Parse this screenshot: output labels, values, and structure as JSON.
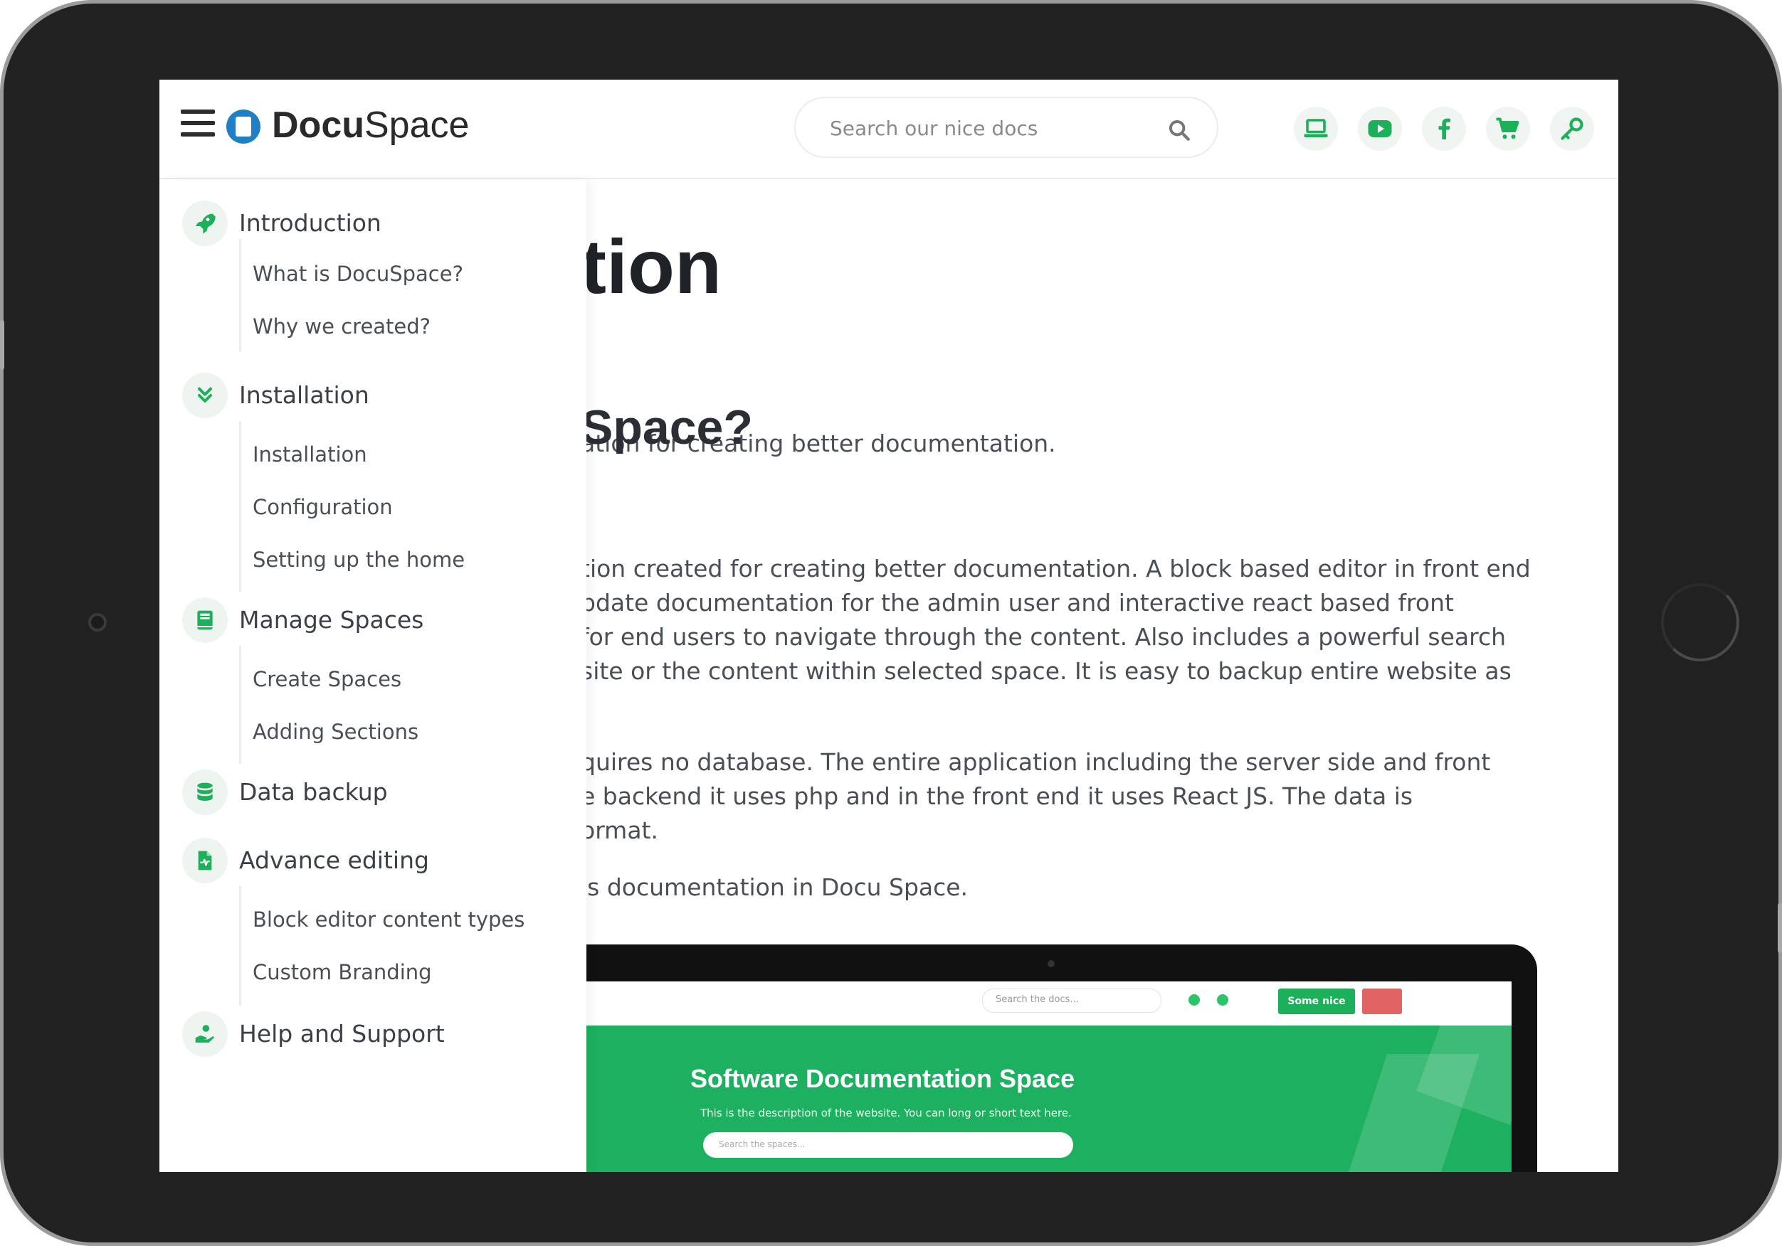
{
  "brand": {
    "name_bold": "Docu",
    "name_light": "Space"
  },
  "search": {
    "placeholder": "Search our nice docs"
  },
  "header_icons": [
    "laptop-icon",
    "youtube-icon",
    "facebook-icon",
    "cart-icon",
    "key-icon"
  ],
  "colors": {
    "accent": "#1db05a",
    "text": "#3b4048",
    "brand_blue": "#1f7fc4"
  },
  "sidebar": {
    "sections": [
      {
        "label": "Introduction",
        "icon": "rocket-icon",
        "items": [
          "What is DocuSpace?",
          "Why we created?"
        ]
      },
      {
        "label": "Installation",
        "icon": "double-chevron-down-icon",
        "items": [
          "Installation",
          "Configuration",
          "Setting up the home"
        ]
      },
      {
        "label": "Manage Spaces",
        "icon": "book-icon",
        "items": [
          "Create Spaces",
          "Adding Sections"
        ]
      },
      {
        "label": "Data backup",
        "icon": "database-icon",
        "items": []
      },
      {
        "label": "Advance editing",
        "icon": "file-pulse-icon",
        "items": [
          "Block editor content types",
          "Custom Branding"
        ]
      },
      {
        "label": "Help and Support",
        "icon": "hand-user-icon",
        "items": []
      }
    ]
  },
  "content": {
    "title_fragment": "tion",
    "intro_fragment": "ation for creating better documentation.",
    "h2_fragment": "Space?",
    "para1": [
      "tion created for creating better documentation. A block based editor in front end",
      "pdate documentation for the admin user and interactive react based front",
      " for end users to navigate through the content. Also includes a powerful search",
      "site or the content within selected space.  It is easy to backup entire website as"
    ],
    "para2": [
      "quires no database. The entire application including the server side and front",
      "e backend it uses php and in the front end it uses React JS. The data is",
      "ormat."
    ],
    "para3": "is documentation in Docu Space."
  },
  "mockup": {
    "search_placeholder": "Search the docs...",
    "button_label": "Some nice",
    "hero_title": "Software Documentation Space",
    "hero_desc": "This is the description of the website. You can long or short text here.",
    "hero_search": "Search the spaces..."
  }
}
